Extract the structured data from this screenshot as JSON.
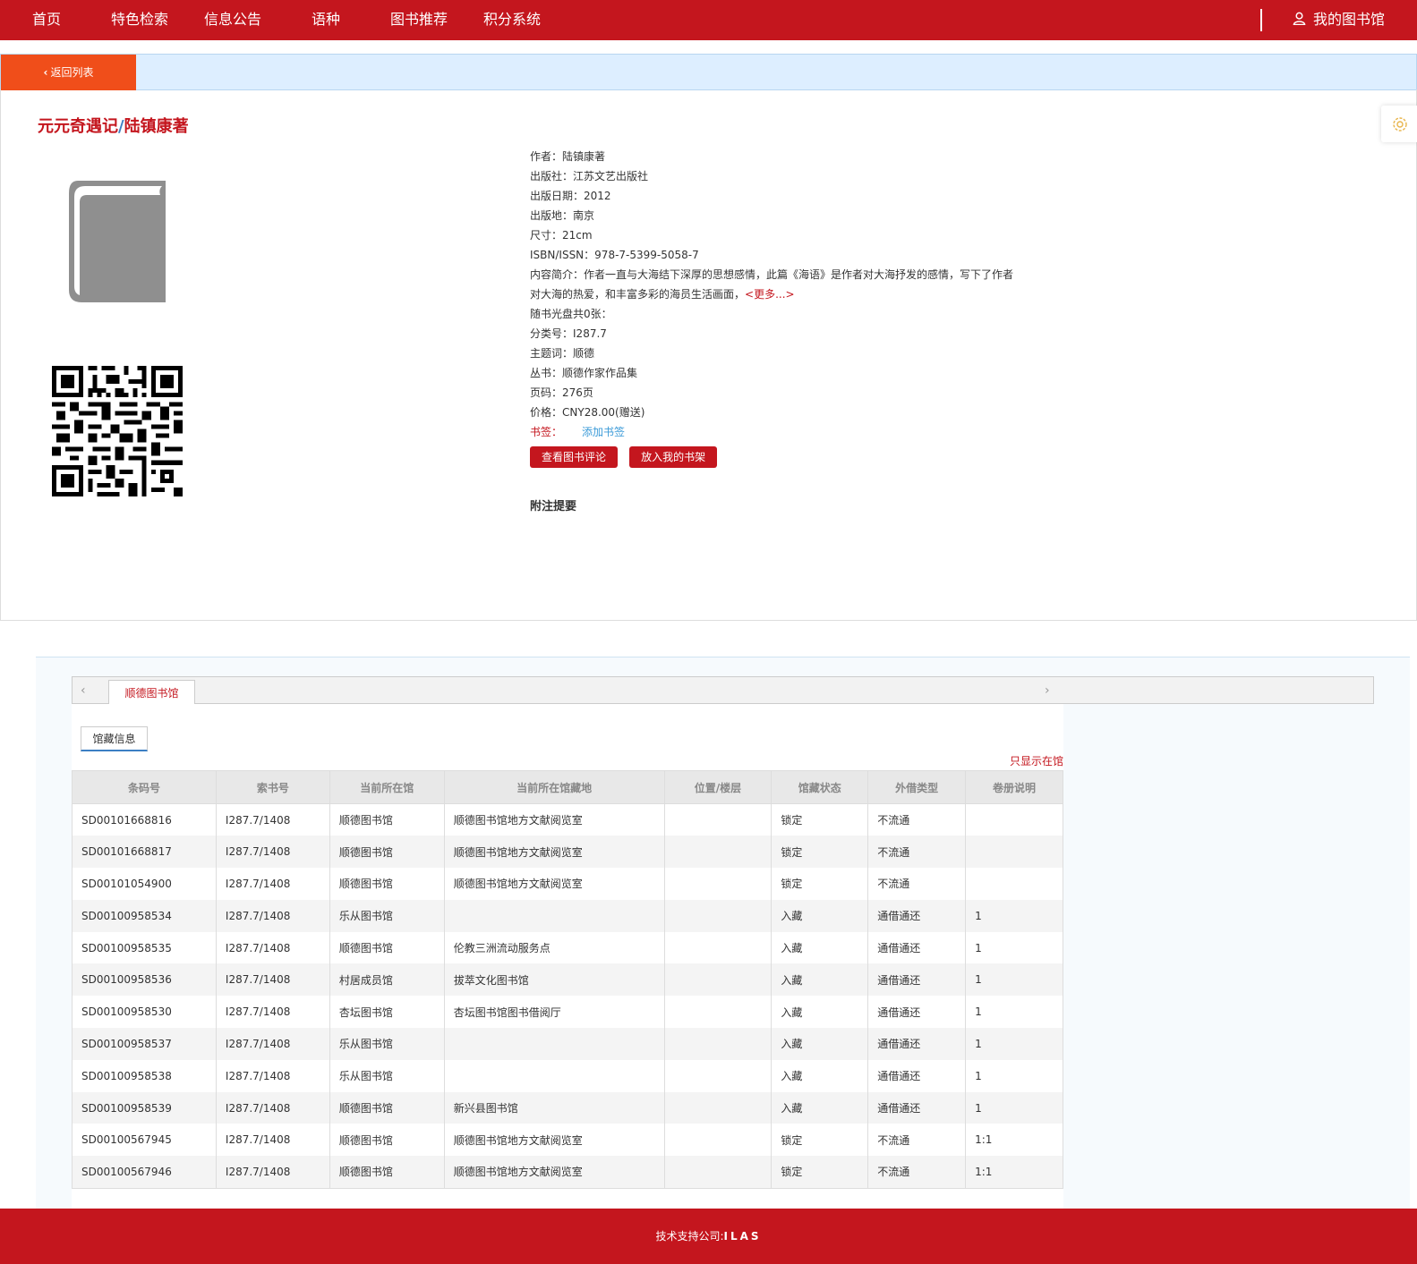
{
  "nav": {
    "items": [
      "首页",
      "特色检索",
      "信息公告",
      "语种",
      "图书推荐",
      "积分系统"
    ],
    "my_library": "我的图书馆"
  },
  "back": {
    "label": "返回列表"
  },
  "book": {
    "title": "元元奇遇记",
    "separator": "/",
    "author_statement": "陆镇康著",
    "meta": [
      {
        "label": "作者：",
        "value": "陆镇康著"
      },
      {
        "label": "出版社：",
        "value": "江苏文艺出版社"
      },
      {
        "label": "出版日期：",
        "value": "2012"
      },
      {
        "label": "出版地：",
        "value": "南京"
      },
      {
        "label": "尺寸：",
        "value": "21cm"
      },
      {
        "label": "ISBN/ISSN：",
        "value": "978-7-5399-5058-7"
      }
    ],
    "summary_label": "内容简介：",
    "summary": "作者一直与大海结下深厚的思想感情，此篇《海语》是作者对大海抒发的感情，写下了作者对大海的热爱，和丰富多彩的海员生活画面，",
    "more": "<更多...>",
    "meta2": [
      {
        "label": "随书光盘共0张：",
        "value": ""
      },
      {
        "label": "分类号：",
        "value": "I287.7"
      },
      {
        "label": "主题词：",
        "value": "顺德"
      },
      {
        "label": "丛书：",
        "value": "顺德作家作品集"
      },
      {
        "label": "页码：",
        "value": "276页"
      },
      {
        "label": "价格：",
        "value": "CNY28.00(赠送)"
      }
    ],
    "bookmark_label": "书签：",
    "bookmark_add": "添加书签",
    "btn_reviews": "查看图书评论",
    "btn_shelf": "放入我的书架",
    "notes_title": "附注提要"
  },
  "holdings": {
    "tab_library": "顺德图书馆",
    "subtab": "馆藏信息",
    "only_in_library": "只显示在馆",
    "columns": [
      "条码号",
      "索书号",
      "当前所在馆",
      "当前所在馆藏地",
      "位置/楼层",
      "馆藏状态",
      "外借类型",
      "卷册说明"
    ],
    "rows": [
      [
        "SD00101668816",
        "I287.7/1408",
        "顺德图书馆",
        "顺德图书馆地方文献阅览室",
        "",
        "锁定",
        "不流通",
        ""
      ],
      [
        "SD00101668817",
        "I287.7/1408",
        "顺德图书馆",
        "顺德图书馆地方文献阅览室",
        "",
        "锁定",
        "不流通",
        ""
      ],
      [
        "SD00101054900",
        "I287.7/1408",
        "顺德图书馆",
        "顺德图书馆地方文献阅览室",
        "",
        "锁定",
        "不流通",
        ""
      ],
      [
        "SD00100958534",
        "I287.7/1408",
        "乐从图书馆",
        "",
        "",
        "入藏",
        "通借通还",
        "1"
      ],
      [
        "SD00100958535",
        "I287.7/1408",
        "顺德图书馆",
        "伦教三洲流动服务点",
        "",
        "入藏",
        "通借通还",
        "1"
      ],
      [
        "SD00100958536",
        "I287.7/1408",
        "村居成员馆",
        "拔萃文化图书馆",
        "",
        "入藏",
        "通借通还",
        "1"
      ],
      [
        "SD00100958530",
        "I287.7/1408",
        "杏坛图书馆",
        "杏坛图书馆图书借阅厅",
        "",
        "入藏",
        "通借通还",
        "1"
      ],
      [
        "SD00100958537",
        "I287.7/1408",
        "乐从图书馆",
        "",
        "",
        "入藏",
        "通借通还",
        "1"
      ],
      [
        "SD00100958538",
        "I287.7/1408",
        "乐从图书馆",
        "",
        "",
        "入藏",
        "通借通还",
        "1"
      ],
      [
        "SD00100958539",
        "I287.7/1408",
        "顺德图书馆",
        "新兴县图书馆",
        "",
        "入藏",
        "通借通还",
        "1"
      ],
      [
        "SD00100567945",
        "I287.7/1408",
        "顺德图书馆",
        "顺德图书馆地方文献阅览室",
        "",
        "锁定",
        "不流通",
        "1:1"
      ],
      [
        "SD00100567946",
        "I287.7/1408",
        "顺德图书馆",
        "顺德图书馆地方文献阅览室",
        "",
        "锁定",
        "不流通",
        "1:1"
      ]
    ]
  },
  "footer": {
    "label": "技术支持公司:",
    "company": "ILAS"
  },
  "colors": {
    "brand_red": "#c4161e",
    "back_orange": "#f04e1a",
    "bar_blue": "#ddeeff",
    "link_blue": "#3c9bd8"
  },
  "icons": [
    "user-icon",
    "chevron-left-icon",
    "book-cover-icon",
    "qr-code-icon",
    "settings-icon",
    "chevron-right-icon"
  ]
}
